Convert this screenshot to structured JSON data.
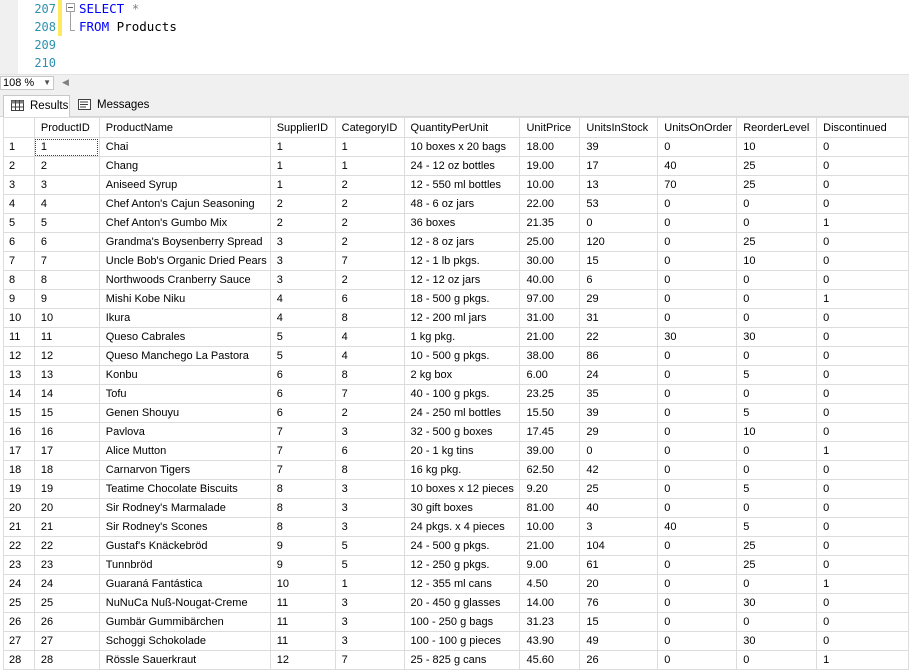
{
  "editor": {
    "line_numbers": [
      "207",
      "208",
      "209",
      "210"
    ],
    "line1_keyword": "SELECT",
    "line1_op": "*",
    "line2_keyword": "FROM",
    "line2_ident": "Products"
  },
  "zoom": {
    "value": "108 %"
  },
  "tabs": [
    {
      "label": "Results",
      "icon": "grid-icon"
    },
    {
      "label": "Messages",
      "icon": "messages-icon"
    }
  ],
  "grid": {
    "columns": [
      "ProductID",
      "ProductName",
      "SupplierID",
      "CategoryID",
      "QuantityPerUnit",
      "UnitPrice",
      "UnitsInStock",
      "UnitsOnOrder",
      "ReorderLevel",
      "Discontinued"
    ],
    "rows": [
      [
        "1",
        "1",
        "Chai",
        "1",
        "1",
        "10 boxes x 20 bags",
        "18.00",
        "39",
        "0",
        "10",
        "0"
      ],
      [
        "2",
        "2",
        "Chang",
        "1",
        "1",
        "24 - 12 oz bottles",
        "19.00",
        "17",
        "40",
        "25",
        "0"
      ],
      [
        "3",
        "3",
        "Aniseed Syrup",
        "1",
        "2",
        "12 - 550 ml bottles",
        "10.00",
        "13",
        "70",
        "25",
        "0"
      ],
      [
        "4",
        "4",
        "Chef Anton's Cajun Seasoning",
        "2",
        "2",
        "48 - 6 oz jars",
        "22.00",
        "53",
        "0",
        "0",
        "0"
      ],
      [
        "5",
        "5",
        "Chef Anton's Gumbo Mix",
        "2",
        "2",
        "36 boxes",
        "21.35",
        "0",
        "0",
        "0",
        "1"
      ],
      [
        "6",
        "6",
        "Grandma's Boysenberry Spread",
        "3",
        "2",
        "12 - 8 oz jars",
        "25.00",
        "120",
        "0",
        "25",
        "0"
      ],
      [
        "7",
        "7",
        "Uncle Bob's Organic Dried Pears",
        "3",
        "7",
        "12 - 1 lb pkgs.",
        "30.00",
        "15",
        "0",
        "10",
        "0"
      ],
      [
        "8",
        "8",
        "Northwoods Cranberry Sauce",
        "3",
        "2",
        "12 - 12 oz jars",
        "40.00",
        "6",
        "0",
        "0",
        "0"
      ],
      [
        "9",
        "9",
        "Mishi Kobe Niku",
        "4",
        "6",
        "18 - 500 g pkgs.",
        "97.00",
        "29",
        "0",
        "0",
        "1"
      ],
      [
        "10",
        "10",
        "Ikura",
        "4",
        "8",
        "12 - 200 ml jars",
        "31.00",
        "31",
        "0",
        "0",
        "0"
      ],
      [
        "11",
        "11",
        "Queso Cabrales",
        "5",
        "4",
        "1 kg pkg.",
        "21.00",
        "22",
        "30",
        "30",
        "0"
      ],
      [
        "12",
        "12",
        "Queso Manchego La Pastora",
        "5",
        "4",
        "10 - 500 g pkgs.",
        "38.00",
        "86",
        "0",
        "0",
        "0"
      ],
      [
        "13",
        "13",
        "Konbu",
        "6",
        "8",
        "2 kg box",
        "6.00",
        "24",
        "0",
        "5",
        "0"
      ],
      [
        "14",
        "14",
        "Tofu",
        "6",
        "7",
        "40 - 100 g pkgs.",
        "23.25",
        "35",
        "0",
        "0",
        "0"
      ],
      [
        "15",
        "15",
        "Genen Shouyu",
        "6",
        "2",
        "24 - 250 ml bottles",
        "15.50",
        "39",
        "0",
        "5",
        "0"
      ],
      [
        "16",
        "16",
        "Pavlova",
        "7",
        "3",
        "32 - 500 g boxes",
        "17.45",
        "29",
        "0",
        "10",
        "0"
      ],
      [
        "17",
        "17",
        "Alice Mutton",
        "7",
        "6",
        "20 - 1 kg tins",
        "39.00",
        "0",
        "0",
        "0",
        "1"
      ],
      [
        "18",
        "18",
        "Carnarvon Tigers",
        "7",
        "8",
        "16 kg pkg.",
        "62.50",
        "42",
        "0",
        "0",
        "0"
      ],
      [
        "19",
        "19",
        "Teatime Chocolate Biscuits",
        "8",
        "3",
        "10 boxes x 12 pieces",
        "9.20",
        "25",
        "0",
        "5",
        "0"
      ],
      [
        "20",
        "20",
        "Sir Rodney's Marmalade",
        "8",
        "3",
        "30 gift boxes",
        "81.00",
        "40",
        "0",
        "0",
        "0"
      ],
      [
        "21",
        "21",
        "Sir Rodney's Scones",
        "8",
        "3",
        "24 pkgs. x 4 pieces",
        "10.00",
        "3",
        "40",
        "5",
        "0"
      ],
      [
        "22",
        "22",
        "Gustaf's Knäckebröd",
        "9",
        "5",
        "24 - 500 g pkgs.",
        "21.00",
        "104",
        "0",
        "25",
        "0"
      ],
      [
        "23",
        "23",
        "Tunnbröd",
        "9",
        "5",
        "12 - 250 g pkgs.",
        "9.00",
        "61",
        "0",
        "25",
        "0"
      ],
      [
        "24",
        "24",
        "Guaraná Fantástica",
        "10",
        "1",
        "12 - 355 ml cans",
        "4.50",
        "20",
        "0",
        "0",
        "1"
      ],
      [
        "25",
        "25",
        "NuNuCa Nuß-Nougat-Creme",
        "11",
        "3",
        "20 - 450 g glasses",
        "14.00",
        "76",
        "0",
        "30",
        "0"
      ],
      [
        "26",
        "26",
        "Gumbär Gummibärchen",
        "11",
        "3",
        "100 - 250 g bags",
        "31.23",
        "15",
        "0",
        "0",
        "0"
      ],
      [
        "27",
        "27",
        "Schoggi Schokolade",
        "11",
        "3",
        "100 - 100 g pieces",
        "43.90",
        "49",
        "0",
        "30",
        "0"
      ],
      [
        "28",
        "28",
        "Rössle Sauerkraut",
        "12",
        "7",
        "25 - 825 g cans",
        "45.60",
        "26",
        "0",
        "0",
        "1"
      ]
    ]
  }
}
